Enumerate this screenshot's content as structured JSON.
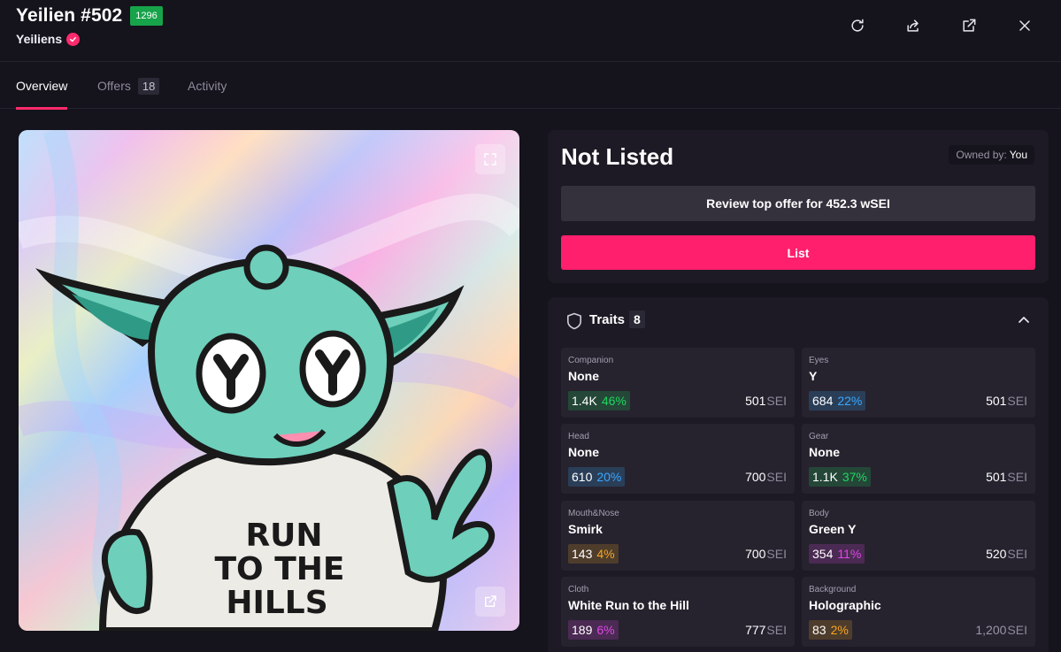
{
  "header": {
    "title": "Yeilien #502",
    "rank": "1296",
    "collection": "Yeiliens",
    "icons": [
      "refresh-icon",
      "share-icon",
      "external-link-icon",
      "close-icon"
    ]
  },
  "tabs": [
    {
      "label": "Overview",
      "active": true
    },
    {
      "label": "Offers",
      "count": "18"
    },
    {
      "label": "Activity"
    }
  ],
  "nft_image": {
    "shirt_text": [
      "RUN",
      "TO THE",
      "HILLS"
    ],
    "icons": [
      "expand-icon",
      "open-new-icon"
    ]
  },
  "listing": {
    "status": "Not Listed",
    "owned_by_label": "Owned by:",
    "owner": "You",
    "offer_button": "Review top offer for 452.3 wSEI",
    "list_button": "List"
  },
  "traits": {
    "title": "Traits",
    "count": "8",
    "items": [
      {
        "type": "Companion",
        "value": "None",
        "count": "1.4K",
        "percent": "46%",
        "price": "501",
        "unit": "SEI",
        "stat_color": "#1ed760"
      },
      {
        "type": "Eyes",
        "value": "Y",
        "count": "684",
        "percent": "22%",
        "price": "501",
        "unit": "SEI",
        "stat_color": "#3aa8ff"
      },
      {
        "type": "Head",
        "value": "None",
        "count": "610",
        "percent": "20%",
        "price": "700",
        "unit": "SEI",
        "stat_color": "#3aa8ff"
      },
      {
        "type": "Gear",
        "value": "None",
        "count": "1.1K",
        "percent": "37%",
        "price": "501",
        "unit": "SEI",
        "stat_color": "#1ed760"
      },
      {
        "type": "Mouth&Nose",
        "value": "Smirk",
        "count": "143",
        "percent": "4%",
        "price": "700",
        "unit": "SEI",
        "stat_color": "#f5a524"
      },
      {
        "type": "Body",
        "value": "Green Y",
        "count": "354",
        "percent": "11%",
        "price": "520",
        "unit": "SEI",
        "stat_color": "#e046e8"
      },
      {
        "type": "Cloth",
        "value": "White Run to the Hill",
        "count": "189",
        "percent": "6%",
        "price": "777",
        "unit": "SEI",
        "stat_color": "#e046e8"
      },
      {
        "type": "Background",
        "value": "Holographic",
        "count": "83",
        "percent": "2%",
        "price": "1,200",
        "unit": "SEI",
        "stat_color": "#f5a524"
      }
    ]
  },
  "colors": {
    "accent": "#ff1f6c",
    "background": "#15131c",
    "panel": "#1d1a25",
    "card": "#26232f"
  }
}
